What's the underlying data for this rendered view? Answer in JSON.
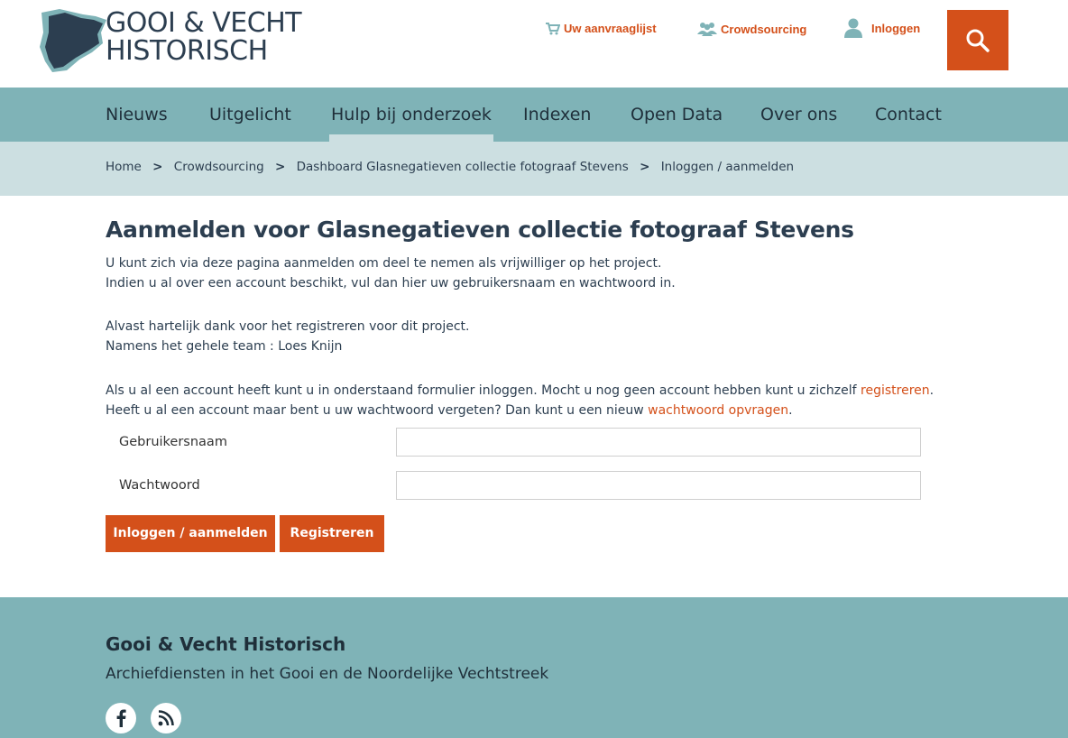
{
  "header": {
    "logo_line1": "GOOI & VECHT",
    "logo_line2": "HISTORISCH",
    "links": [
      {
        "label": "Uw aanvraaglijst",
        "icon": "cart-icon"
      },
      {
        "label": "Crowdsourcing",
        "icon": "people-icon"
      },
      {
        "label": "Inloggen",
        "icon": "user-icon"
      }
    ],
    "search_icon": "search-icon"
  },
  "nav": {
    "items": [
      "Nieuws",
      "Uitgelicht",
      "Hulp bij onderzoek",
      "Indexen",
      "Open Data",
      "Over ons",
      "Contact"
    ],
    "active": "Hulp bij onderzoek"
  },
  "breadcrumb": {
    "items": [
      "Home",
      "Crowdsourcing",
      "Dashboard Glasnegatieven collectie fotograaf Stevens",
      "Inloggen / aanmelden"
    ],
    "separator": ">"
  },
  "main": {
    "title": "Aanmelden voor Glasnegatieven collectie fotograaf Stevens",
    "intro_line1": "U kunt zich via deze pagina aanmelden om deel te nemen als vrijwilliger op het project.",
    "intro_line2": "Indien u al over een account beschikt, vul dan hier uw gebruikersnaam en wachtwoord in.",
    "thanks_line1": "Alvast hartelijk dank voor het registreren voor dit project.",
    "thanks_line2": "Namens het gehele team : Loes Knijn",
    "login_text": "Als u al een account heeft kunt u in onderstaand formulier inloggen. Mocht u nog geen account hebben kunt u zichzelf",
    "login_link": "registreren",
    "forgot_text": "Heeft u al een account maar bent u uw wachtwoord vergeten? Dan kunt u een nieuw",
    "forgot_link": "wachtwoord opvragen",
    "username_label": "Gebruikersnaam",
    "username_value": "",
    "password_label": "Wachtwoord",
    "password_value": "",
    "login_button": "Inloggen / aanmelden",
    "register_button": "Registreren"
  },
  "footer": {
    "title": "Gooi & Vecht Historisch",
    "subtitle": "Archiefdiensten in het Gooi en de Noordelijke Vechtstreek",
    "social": [
      "facebook-icon",
      "rss-icon"
    ]
  },
  "colors": {
    "accent": "#d4501a",
    "nav_bg": "#7fb3b7",
    "breadcrumb_bg": "#ccdfe1",
    "text_dark": "#2c3e50"
  }
}
